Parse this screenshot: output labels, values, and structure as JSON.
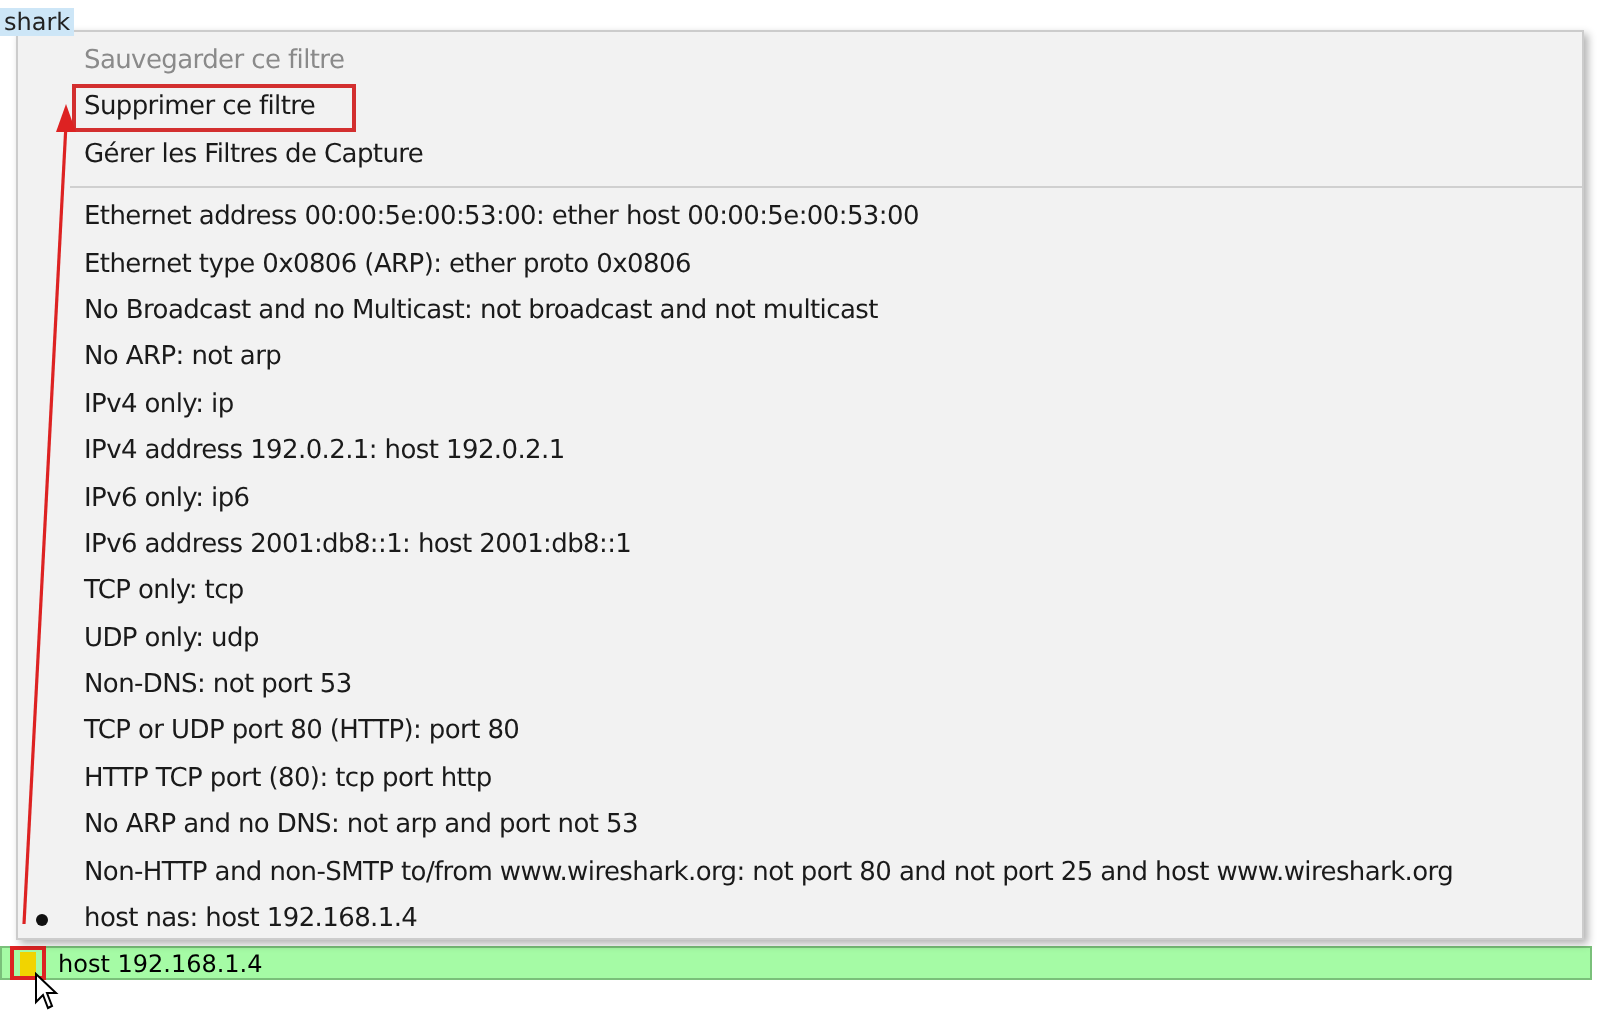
{
  "background_text": "shark",
  "menu": {
    "actions": [
      {
        "label": "Sauvegarder ce filtre",
        "disabled": true,
        "highlighted": false
      },
      {
        "label": "Supprimer ce filtre",
        "disabled": false,
        "highlighted": true
      },
      {
        "label": "Gérer les Filtres de Capture",
        "disabled": false,
        "highlighted": false
      }
    ],
    "filters": [
      {
        "label": "Ethernet address 00:00:5e:00:53:00: ether host 00:00:5e:00:53:00",
        "checked": false
      },
      {
        "label": "Ethernet type 0x0806 (ARP): ether proto 0x0806",
        "checked": false
      },
      {
        "label": "No Broadcast and no Multicast: not broadcast and not multicast",
        "checked": false
      },
      {
        "label": "No ARP: not arp",
        "checked": false
      },
      {
        "label": "IPv4 only: ip",
        "checked": false
      },
      {
        "label": "IPv4 address 192.0.2.1: host 192.0.2.1",
        "checked": false
      },
      {
        "label": "IPv6 only: ip6",
        "checked": false
      },
      {
        "label": "IPv6 address 2001:db8::1: host 2001:db8::1",
        "checked": false
      },
      {
        "label": "TCP only: tcp",
        "checked": false
      },
      {
        "label": "UDP only: udp",
        "checked": false
      },
      {
        "label": "Non-DNS: not port 53",
        "checked": false
      },
      {
        "label": "TCP or UDP port 80 (HTTP): port 80",
        "checked": false
      },
      {
        "label": "HTTP TCP port (80): tcp port http",
        "checked": false
      },
      {
        "label": "No ARP and no DNS: not arp and port not 53",
        "checked": false
      },
      {
        "label": "Non-HTTP and non-SMTP to/from www.wireshark.org: not port 80 and not port 25 and host www.wireshark.org",
        "checked": false
      },
      {
        "label": "host nas: host 192.168.1.4",
        "checked": true
      }
    ]
  },
  "filter_bar": {
    "value": "host 192.168.1.4"
  }
}
